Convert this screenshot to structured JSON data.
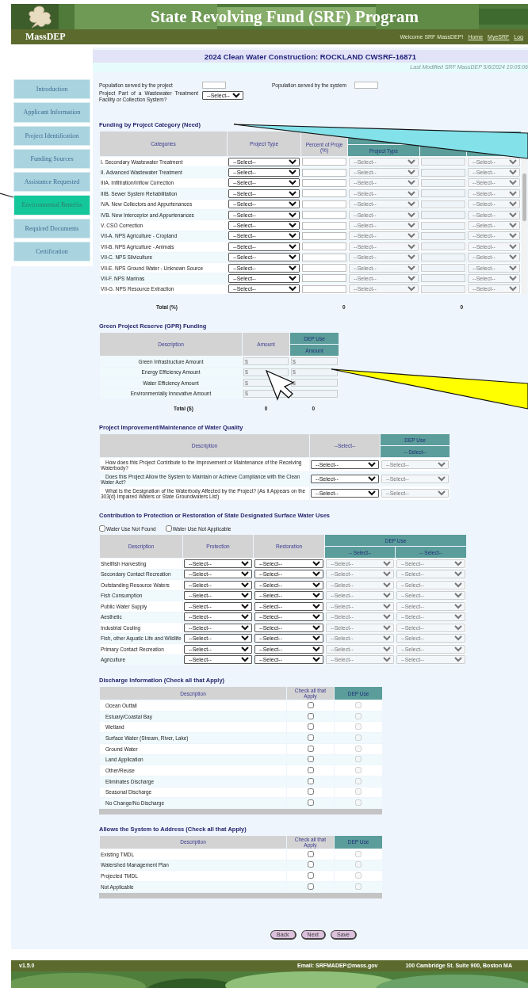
{
  "header": {
    "title": "State Revolving Fund (SRF) Program",
    "logo_text": "MassDEP",
    "welcome": "Welcome SRF MassDEP!",
    "links": [
      "Home",
      "MyeSRF",
      "Log"
    ]
  },
  "page_title": "2024 Clean Water Construction: ROCKLAND CWSRF-16871",
  "last_modified": "Last Modified SRF MassDEP 5/6/2024 10:05:06",
  "sidebar": [
    {
      "label": "Introduction",
      "selected": false
    },
    {
      "label": "Applicant Information",
      "selected": false
    },
    {
      "label": "Project Identification",
      "selected": false
    },
    {
      "label": "Funding Sources",
      "selected": false
    },
    {
      "label": "Assistance Requested",
      "selected": false
    },
    {
      "label": "Environmental Benefits",
      "selected": true
    },
    {
      "label": "Required Documents",
      "selected": false
    },
    {
      "label": "Certification",
      "selected": false
    }
  ],
  "population": {
    "project_label": "Population served by the project",
    "system_label": "Population served by the system",
    "part_label": "Project Part of a Wastewater Treatment Facility or Collection System?",
    "part_value": "--Select--"
  },
  "funding": {
    "heading": "Funding by Project Category (Need)",
    "columns": {
      "categories": "Categories",
      "project_type": "Project Type",
      "percent": "Percent of Proje\n(%)",
      "dep_project_type": "Project Type"
    },
    "rows": [
      {
        "category": "I. Secondary Wastewater Treatment",
        "project_type": "--Select--",
        "dep_project_type": "--Select--",
        "dep_option": "--Select--"
      },
      {
        "category": "II. Advanced Wastewater Treatment",
        "project_type": "--Select--",
        "dep_project_type": "--Select--",
        "dep_option": "--Select--"
      },
      {
        "category": "IIIA. Infiltration/Inflow Correction",
        "project_type": "--Select--",
        "dep_project_type": "--Select--",
        "dep_option": "--Select--"
      },
      {
        "category": "IIIB. Sewer System Rehabilitation",
        "project_type": "--Select--",
        "dep_project_type": "--Select--",
        "dep_option": "--Select--"
      },
      {
        "category": "IVA. New Collectors and Appurtenances",
        "project_type": "--Select--",
        "dep_project_type": "--Select--",
        "dep_option": "--Select--"
      },
      {
        "category": "IVB. New Interceptor and Appurtenances",
        "project_type": "--Select--",
        "dep_project_type": "--Select--",
        "dep_option": "--Select--"
      },
      {
        "category": "V. CSO Correction",
        "project_type": "--Select--",
        "dep_project_type": "--Select--",
        "dep_option": "--Select--"
      },
      {
        "category": "VII-A. NPS Agriculture - Cropland",
        "project_type": "--Select--",
        "dep_project_type": "--Select--",
        "dep_option": "--Select--"
      },
      {
        "category": "VII-B. NPS Agriculture - Animals",
        "project_type": "--Select--",
        "dep_project_type": "--Select--",
        "dep_option": "--Select--"
      },
      {
        "category": "VII-C. NPS Silviculture",
        "project_type": "--Select--",
        "dep_project_type": "--Select--",
        "dep_option": "--Select--"
      },
      {
        "category": "VII-E. NPS Ground Water - Unknown Source",
        "project_type": "--Select--",
        "dep_project_type": "--Select--",
        "dep_option": "--Select--"
      },
      {
        "category": "VII-F. NPS Marinas",
        "project_type": "--Select--",
        "dep_project_type": "--Select--",
        "dep_option": "--Select--"
      },
      {
        "category": "VII-G. NPS Resource Extraction",
        "project_type": "--Select--",
        "dep_project_type": "--Select--",
        "dep_option": "--Select--"
      }
    ],
    "total_label": "Total (%)",
    "total": "0",
    "dep_total": "0"
  },
  "gpr": {
    "heading": "Green Project Reserve (GPR) Funding",
    "columns": {
      "description": "Description",
      "amount": "Amount",
      "dep_group": "DEP Use",
      "dep_amount": "Amount"
    },
    "rows": [
      {
        "description": "Green Infrastructure Amount",
        "amount_placeholder": "$",
        "dep_amount_placeholder": "$"
      },
      {
        "description": "Energy Efficiency Amount",
        "amount_placeholder": "$",
        "dep_amount_placeholder": "$"
      },
      {
        "description": "Water Efficiency Amount",
        "amount_placeholder": "$",
        "dep_amount_placeholder": "$"
      },
      {
        "description": "Environmentally Innovative Amount",
        "amount_placeholder": "$"
      }
    ],
    "total_label": "Total ($)",
    "total": "0",
    "dep_total": "0"
  },
  "water_quality": {
    "heading": "Project Improvement/Maintenance of Water Quality",
    "columns": {
      "description": "Description",
      "select": "--Select--",
      "dep_group": "DEP Use",
      "dep_select": "-- Select--"
    },
    "rows": [
      {
        "question": "How does this Project Contribute to the Improvement or Maintenance of the Receiving Waterbody?",
        "answer": "--Select--",
        "dep_answer": "--Select--"
      },
      {
        "question": "Does this Project Allow the System to Maintain or Achieve Compliance with the Clean Water Act?",
        "answer": "--Select--",
        "dep_answer": "--Select--"
      },
      {
        "question": "What is the Designation of the Waterbody Affected by the Project? (As it Appears on the 303(d) Impaired Waters or State Groundwaters List)",
        "answer": "--Select--",
        "dep_answer": "--Select--"
      }
    ]
  },
  "water_uses": {
    "heading": "Contribution to Protection or Restoration of State Designated Surface Water Uses",
    "options": [
      {
        "label": "Water Use Not Found",
        "checked": false
      },
      {
        "label": "Water Use Not Applicable",
        "checked": false
      }
    ],
    "columns": {
      "description": "Description",
      "protection": "Protection",
      "restoration": "Restoration",
      "dep_group": "DEP Use",
      "dep_1": "-- Select--",
      "dep_2": "-- Select--"
    },
    "rows": [
      {
        "use": "Shellfish Harvesting",
        "protection": "--Select--",
        "restoration": "--Select--",
        "dep_1": "--Select--",
        "dep_2": "--Select--"
      },
      {
        "use": "Secondary Contact Recreation",
        "protection": "--Select--",
        "restoration": "--Select--",
        "dep_1": "--Select--",
        "dep_2": "--Select--"
      },
      {
        "use": "Outstanding Resource Waters",
        "protection": "--Select--",
        "restoration": "--Select--",
        "dep_1": "--Select--",
        "dep_2": "--Select--"
      },
      {
        "use": "Fish Consumption",
        "protection": "--Select--",
        "restoration": "--Select--",
        "dep_1": "--Select--",
        "dep_2": "--Select--"
      },
      {
        "use": "Public Water Supply",
        "protection": "--Select--",
        "restoration": "--Select--",
        "dep_1": "--Select--",
        "dep_2": "--Select--"
      },
      {
        "use": "Aesthetic",
        "protection": "--Select--",
        "restoration": "--Select--",
        "dep_1": "--Select--",
        "dep_2": "--Select--"
      },
      {
        "use": "Industrial Cooling",
        "protection": "--Select--",
        "restoration": "--Select--",
        "dep_1": "--Select--",
        "dep_2": "--Select--"
      },
      {
        "use": "Fish, other Aquatic Life and Wildlife",
        "protection": "--Select--",
        "restoration": "--Select--",
        "dep_1": "--Select--",
        "dep_2": "--Select--"
      },
      {
        "use": "Primary Contact Recreation",
        "protection": "--Select--",
        "restoration": "--Select--",
        "dep_1": "--Select--",
        "dep_2": "--Select--"
      },
      {
        "use": "Agriculture",
        "protection": "--Select--",
        "restoration": "--Select--",
        "dep_1": "--Select--",
        "dep_2": "--Select--"
      }
    ]
  },
  "discharge": {
    "heading": "Discharge Information (Check all that Apply)",
    "columns": {
      "description": "Description",
      "check": "Check all that Apply",
      "dep": "DEP Use"
    },
    "rows": [
      {
        "label": "Ocean Outfall",
        "checked": false,
        "dep_checked": false
      },
      {
        "label": "Estuary/Coastal Bay",
        "checked": false,
        "dep_checked": false
      },
      {
        "label": "Wetland",
        "checked": false,
        "dep_checked": false
      },
      {
        "label": "Surface Water (Stream, River, Lake)",
        "checked": false,
        "dep_checked": false
      },
      {
        "label": "Ground Water",
        "checked": false,
        "dep_checked": false
      },
      {
        "label": "Land Application",
        "checked": false,
        "dep_checked": false
      },
      {
        "label": "Other/Reuse",
        "checked": false,
        "dep_checked": false
      },
      {
        "label": "Eliminates Discharge",
        "checked": false,
        "dep_checked": false
      },
      {
        "label": "Seasonal Discharge",
        "checked": false,
        "dep_checked": false
      },
      {
        "label": "No Change/No Discharge",
        "checked": false,
        "dep_checked": false
      }
    ]
  },
  "address": {
    "heading": "Allows the System to Address (Check all that Apply)",
    "columns": {
      "description": "Description",
      "check": "Check all that Apply",
      "dep": "DEP Use"
    },
    "rows": [
      {
        "label": "Existing TMDL",
        "checked": false,
        "dep_checked": false
      },
      {
        "label": "Watershed Management Plan",
        "checked": false,
        "dep_checked": false
      },
      {
        "label": "Projected TMDL",
        "checked": false,
        "dep_checked": false
      },
      {
        "label": "Not Applicable",
        "checked": false,
        "dep_checked": false
      }
    ]
  },
  "buttons": [
    "Back",
    "Next",
    "Save"
  ],
  "footer": {
    "version": "v1.5.0",
    "email": "Email: SRFMADEP@mass.gov",
    "address": "100 Cambridge St. Suite 900, Boston MA"
  }
}
